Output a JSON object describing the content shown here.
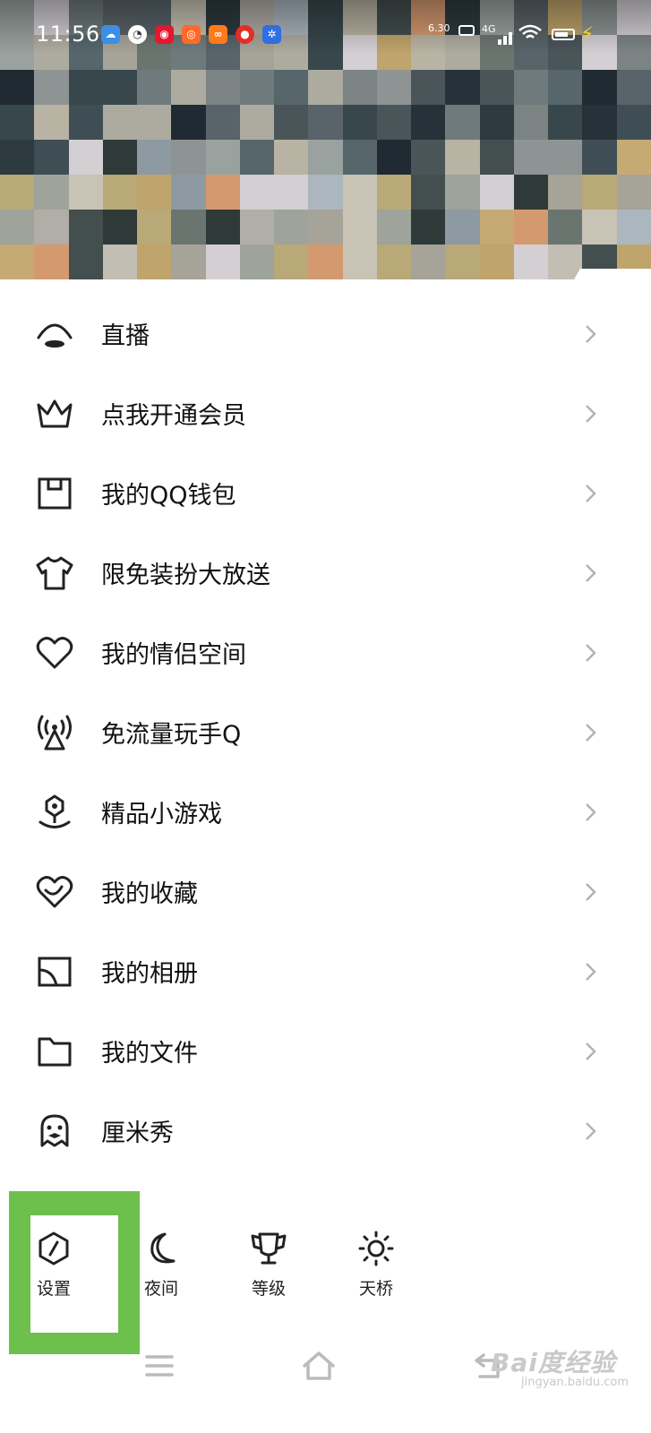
{
  "status_bar": {
    "time": "11:56",
    "net_speed": "6.30",
    "net_type": "4G",
    "app_icons": [
      {
        "name": "baidu-netdisk-icon",
        "color": "#3a8ee8"
      },
      {
        "name": "compass-icon",
        "color": "#ffffff"
      },
      {
        "name": "weibo-icon",
        "color": "#e6162d"
      },
      {
        "name": "douyu-icon",
        "color": "#ff6a2a"
      },
      {
        "name": "orange-app-icon",
        "color": "#ff7a1a"
      },
      {
        "name": "red-app-icon",
        "color": "#e52d27"
      },
      {
        "name": "paw-icon",
        "color": "#2f6fe0"
      }
    ]
  },
  "menu": {
    "items": [
      {
        "label": "直播",
        "icon": "live-icon"
      },
      {
        "label": "点我开通会员",
        "icon": "crown-icon"
      },
      {
        "label": "我的QQ钱包",
        "icon": "wallet-icon"
      },
      {
        "label": "限免装扮大放送",
        "icon": "shirt-icon"
      },
      {
        "label": "我的情侣空间",
        "icon": "heart-icon"
      },
      {
        "label": "免流量玩手Q",
        "icon": "signal-tower-icon"
      },
      {
        "label": "精品小游戏",
        "icon": "joystick-icon"
      },
      {
        "label": "我的收藏",
        "icon": "favorite-heart-icon"
      },
      {
        "label": "我的相册",
        "icon": "album-icon"
      },
      {
        "label": "我的文件",
        "icon": "folder-icon"
      },
      {
        "label": "厘米秀",
        "icon": "ghost-icon"
      }
    ]
  },
  "toolbar": {
    "items": [
      {
        "label": "设置",
        "icon": "settings-hexagon-icon"
      },
      {
        "label": "夜间",
        "icon": "moon-icon"
      },
      {
        "label": "等级",
        "icon": "trophy-icon"
      },
      {
        "label": "天桥",
        "icon": "sun-icon"
      }
    ],
    "highlight_color": "#6dc04b"
  },
  "watermark": {
    "main": "Bai度经验",
    "sub": "jingyan.baidu.com"
  },
  "colors": {
    "icon_stroke": "#222222",
    "chevron": "#b3b3b3"
  }
}
